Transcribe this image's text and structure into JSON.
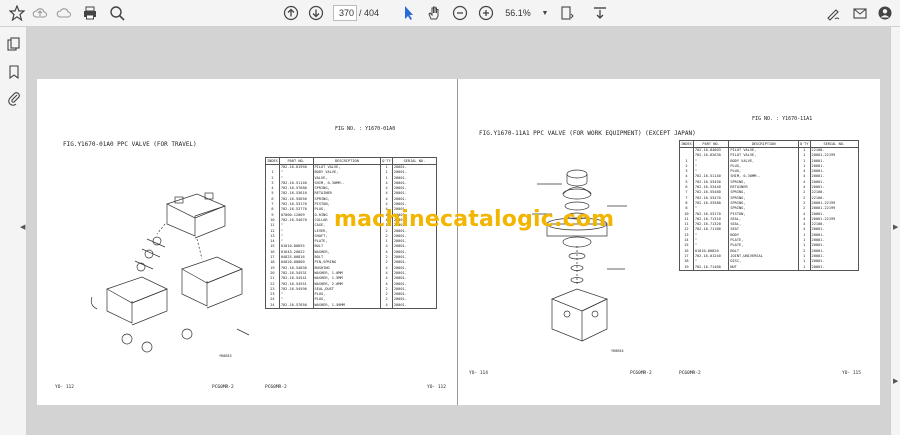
{
  "toolbar": {
    "current_page": "370",
    "total_pages": "/ 404",
    "zoom": "56.1%",
    "icons": [
      "star-icon",
      "upload-icon",
      "print-icon",
      "zoom-search-icon",
      "page-up-icon",
      "page-down-icon",
      "select-cursor-icon",
      "hand-tool-icon",
      "zoom-out-icon",
      "zoom-in-icon",
      "page-fit-icon",
      "scroll-mode-icon",
      "sign-icon",
      "mail-icon",
      "account-icon"
    ]
  },
  "sidebar": {
    "icons": [
      "page-thumbnails-icon",
      "bookmarks-icon",
      "attachments-icon"
    ]
  },
  "watermark": "machinecatalogic.com",
  "left_page": {
    "fig_title": "FIG.Y1670-01A0  PPC VALVE (FOR TRAVEL)",
    "fig_no": "FIG NO.  : Y1670-01A0",
    "footer_left": "YO- 112",
    "footer_model": "PC60MR-2",
    "footer_model2": "PC60MR-2",
    "footer_right": "YO- 112",
    "headers": [
      "INDEX",
      "PART NO.",
      "DESCRIPTION",
      "Q'TY",
      "SERIAL NO."
    ],
    "rows": [
      [
        "",
        "702-16-01950",
        "PILOT VALVE,",
        "1",
        "20001-"
      ],
      [
        "1",
        "\"",
        "BODY VALVE,",
        "1",
        "20001-"
      ],
      [
        "2",
        "\"",
        "VALVE,",
        "1",
        "20001-"
      ],
      [
        "3",
        "702-16-51140",
        "SHIM, 0.30MM..",
        "4",
        "20001-"
      ],
      [
        "4",
        "702-16-57680",
        "SPRING,",
        "4",
        "20001-"
      ],
      [
        "5",
        "702-16-53610",
        "RETAINER",
        "4",
        "20001-"
      ],
      [
        "6",
        "702-16-55650",
        "SPRING,",
        "4",
        "20001-"
      ],
      [
        "7",
        "702-16-53170",
        "PISTON,",
        "4",
        "20001-"
      ],
      [
        "8",
        "702-16-53770",
        "PLUG,",
        "4",
        "20001-"
      ],
      [
        "9",
        "07000-12009",
        "O-RING",
        "4",
        "20001-"
      ],
      [
        "10",
        "702-16-54670",
        "COLLAR",
        "4",
        "20001-"
      ],
      [
        "11",
        "\"",
        "CASE,",
        "1",
        "20001-"
      ],
      [
        "12",
        "\"",
        "LEVER,",
        "2",
        "20001-"
      ],
      [
        "13",
        "\"",
        "SHAFT,",
        "2",
        "20001-"
      ],
      [
        "14",
        "\"",
        "PLATE,",
        "1",
        "20001-"
      ],
      [
        "15",
        "01010-80655",
        "BOLT",
        "4",
        "20001-"
      ],
      [
        "16",
        "01643-20822",
        "WASHER,",
        "4",
        "20001-"
      ],
      [
        "17",
        "04825-00816",
        "BOLT",
        "2",
        "20001-"
      ],
      [
        "18",
        "04020-00800",
        "PIN,SPRING",
        "2",
        "20001-"
      ],
      [
        "19",
        "702-16-54830",
        "BUSHING",
        "4",
        "20001-"
      ],
      [
        "20",
        "702-16-54531",
        "WASHER, 1.0MM",
        "4",
        "20001-"
      ],
      [
        "21",
        "702-16-54541",
        "WASHER, 1.5MM",
        "4",
        "20001-"
      ],
      [
        "22",
        "702-16-54551",
        "WASHER, 2.0MM",
        "4",
        "20001-"
      ],
      [
        "23",
        "702-16-54590",
        "SEAL,DUST",
        "2",
        "20001-"
      ],
      [
        "23",
        "\"",
        "PLUG,",
        "2",
        "20001-"
      ],
      [
        "24",
        "\"",
        "PLUG,",
        "2",
        "20001-"
      ],
      [
        "24",
        "702-16-57650",
        "WASHER, 1.50MM",
        "4",
        "20001-"
      ]
    ]
  },
  "right_page": {
    "fig_title": "FIG.Y1670-11A1  PPC VALVE (FOR WORK EQUIPMENT) (EXCEPT JAPAN)",
    "fig_no": "FIG NO.  : Y1670-11A1",
    "footer_left": "YO- 114",
    "footer_model": "PC60MR-2",
    "footer_model2": "PC60MR-2",
    "footer_right": "YO- 115",
    "headers": [
      "INDEX",
      "PART NO.",
      "DESCRIPTION",
      "Q'TY",
      "SERIAL NO."
    ],
    "rows": [
      [
        "",
        "702-16-04003",
        "PILOT VALVE,",
        "1",
        "22100-"
      ],
      [
        "",
        "702-16-02630",
        "PILOT VALVE,",
        "1",
        "20001-22199"
      ],
      [
        "1",
        "\"",
        "BODY VALVE,",
        "1",
        "20001-"
      ],
      [
        "2",
        "\"",
        "PLUG,",
        "1",
        "20001-"
      ],
      [
        "3",
        "\"",
        "PLUG,",
        "4",
        "20001-"
      ],
      [
        "4",
        "702-16-51140",
        "SHIM, 0.30MM..",
        "4",
        "20001-"
      ],
      [
        "5",
        "702-16-53450",
        "SPRING,",
        "4",
        "20001-"
      ],
      [
        "6",
        "702-16-53440",
        "RETAINER",
        "4",
        "20001-"
      ],
      [
        "7",
        "702-16-55480",
        "SPRING,",
        "2",
        "22100-"
      ],
      [
        "7",
        "702-16-53470",
        "SPRING,",
        "2",
        "22100-"
      ],
      [
        "8",
        "702-16-53580",
        "SPRING,",
        "2",
        "20001-22199"
      ],
      [
        "8",
        "\"",
        "SPRING,",
        "2",
        "20001-22199"
      ],
      [
        "10",
        "702-16-53170",
        "PISTON,",
        "4",
        "20001-"
      ],
      [
        "11",
        "702-16-71310",
        "SEAL,",
        "4",
        "20001-22199"
      ],
      [
        "11",
        "702-16-71320",
        "SEAL,",
        "4",
        "22100-"
      ],
      [
        "12",
        "702-16-71180",
        "SEAT",
        "4",
        "20001-"
      ],
      [
        "13",
        "\"",
        "BODY",
        "1",
        "20001-"
      ],
      [
        "14",
        "\"",
        "PLATE,",
        "1",
        "20001-"
      ],
      [
        "15",
        "\"",
        "PLATE,",
        "1",
        "20001-"
      ],
      [
        "16",
        "01010-80820",
        "BOLT",
        "2",
        "20001-"
      ],
      [
        "17",
        "702-16-01240",
        "JOINT,UNIVERSAL",
        "1",
        "20001-"
      ],
      [
        "18",
        "\"",
        "DISC,",
        "1",
        "20001-"
      ],
      [
        "19",
        "702-16-71460",
        "NUT",
        "1",
        "20001-"
      ]
    ]
  }
}
